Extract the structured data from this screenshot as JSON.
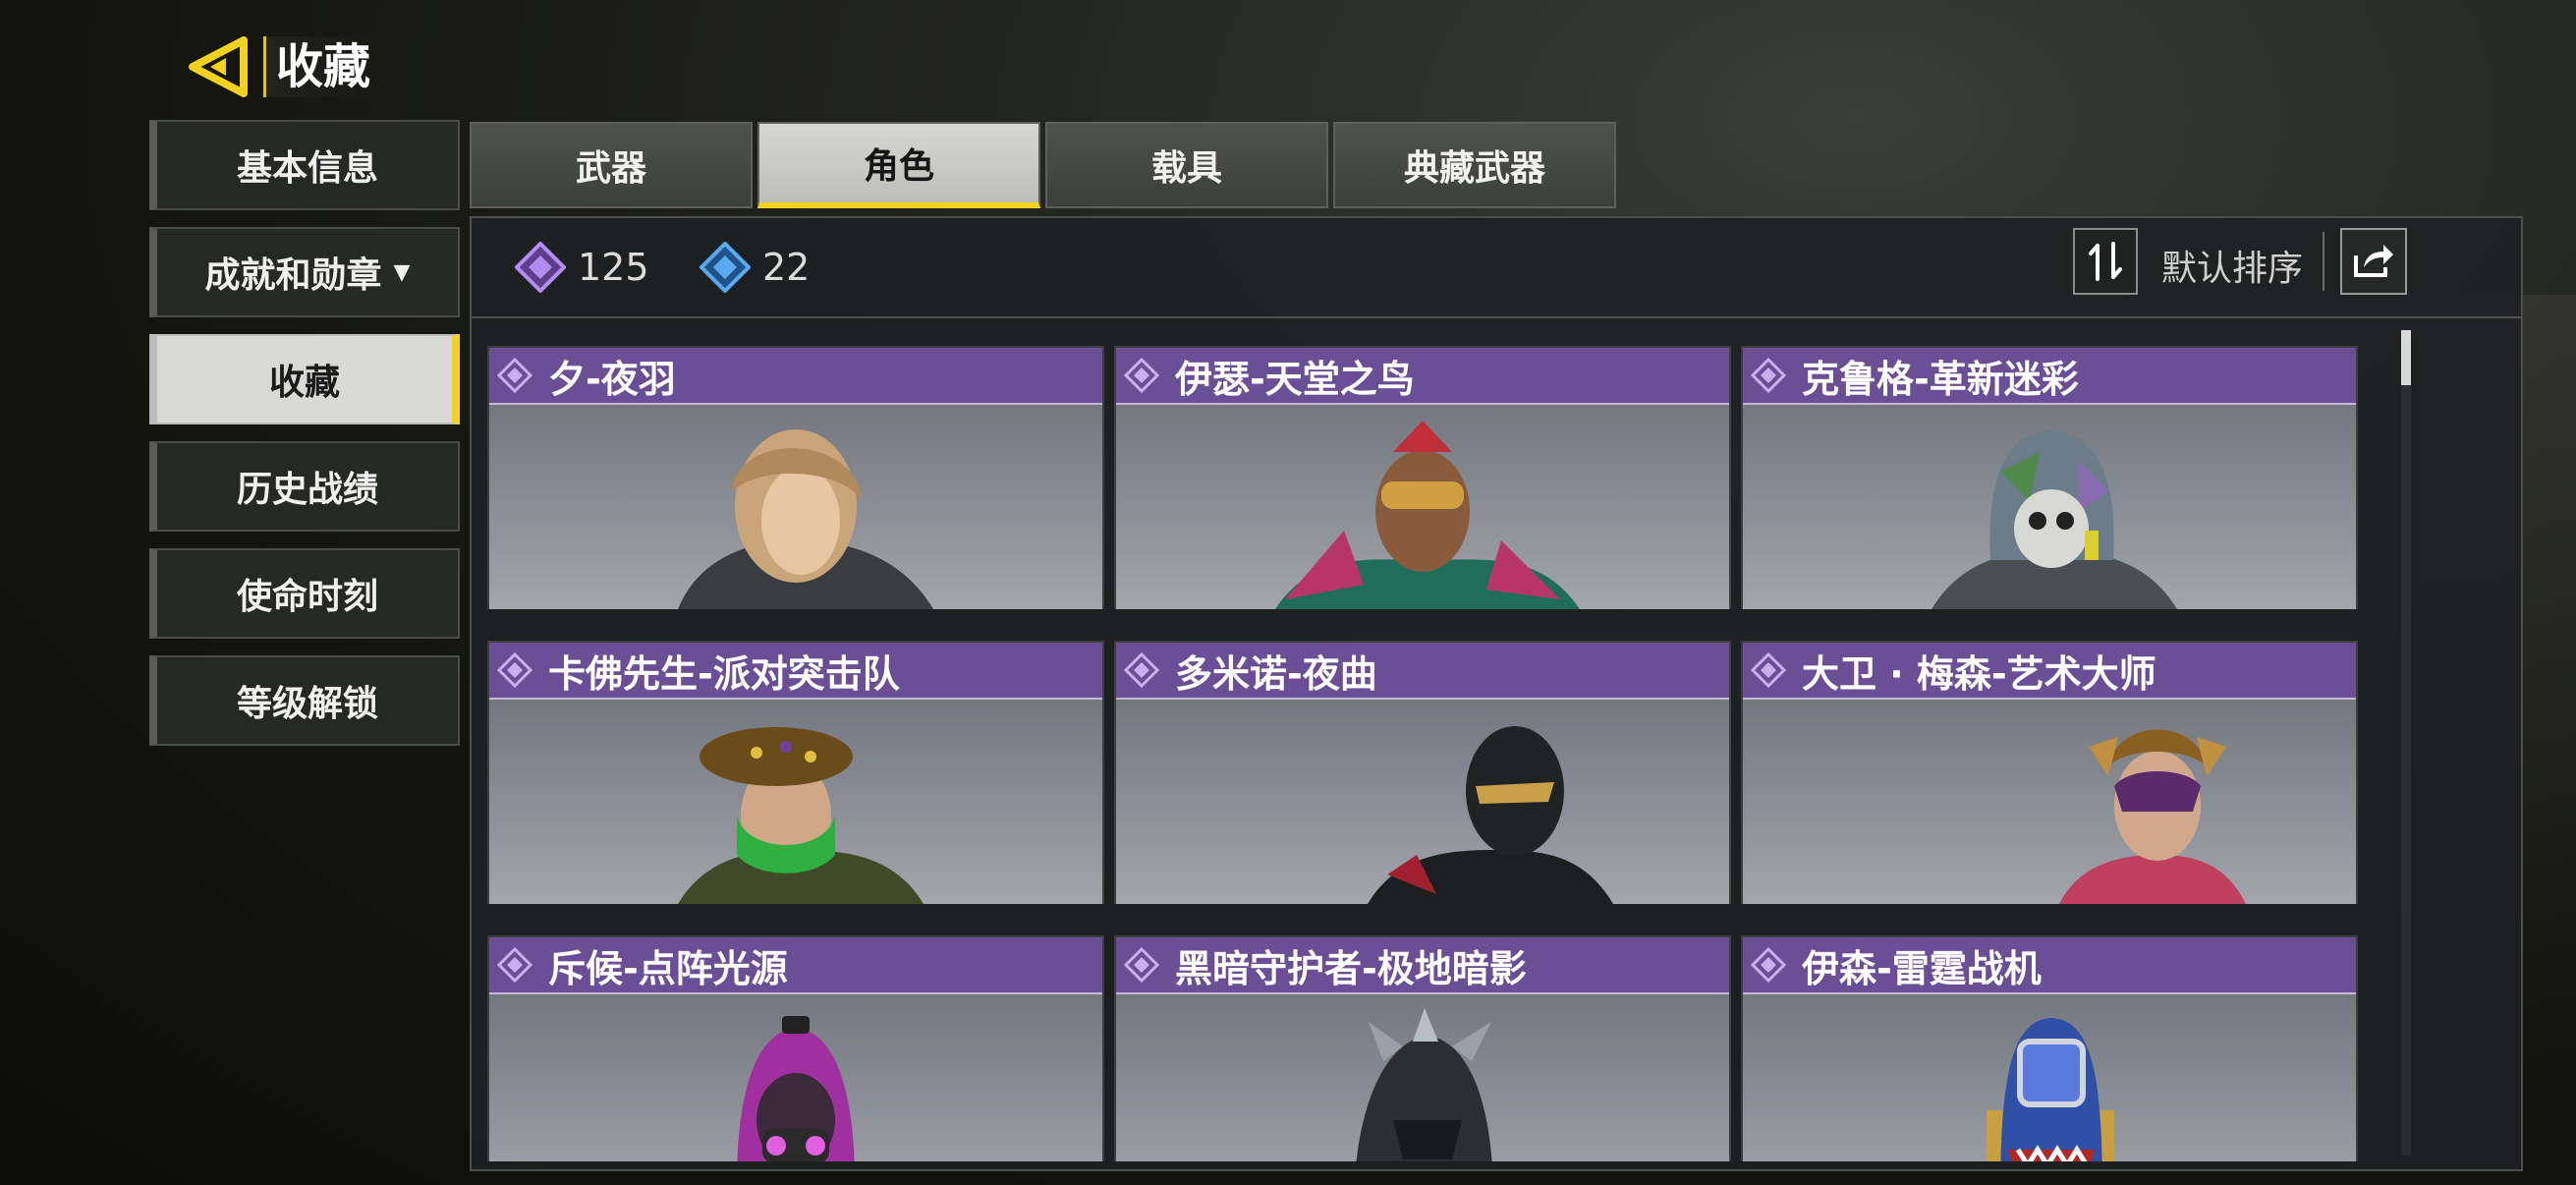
{
  "header": {
    "title": "收藏"
  },
  "sidebar": {
    "items": [
      {
        "label": "基本信息",
        "active": false
      },
      {
        "label": "成就和勋章",
        "active": false,
        "dropdown": true
      },
      {
        "label": "收藏",
        "active": true
      },
      {
        "label": "历史战绩",
        "active": false
      },
      {
        "label": "使命时刻",
        "active": false
      },
      {
        "label": "等级解锁",
        "active": false
      }
    ]
  },
  "tabs": [
    {
      "label": "武器",
      "active": false
    },
    {
      "label": "角色",
      "active": true
    },
    {
      "label": "载具",
      "active": false
    },
    {
      "label": "典藏武器",
      "active": false
    }
  ],
  "currencies": [
    {
      "icon": "purple-diamond-icon",
      "value": "125",
      "color": "#a77be0"
    },
    {
      "icon": "blue-diamond-icon",
      "value": "22",
      "color": "#4f9de0"
    }
  ],
  "sort": {
    "label": "默认排序"
  },
  "cards": [
    {
      "name": "夕-夜羽",
      "portrait": "blonde-woman-portrait"
    },
    {
      "name": "伊瑟-天堂之鸟",
      "portrait": "feathered-mask-portrait"
    },
    {
      "name": "克鲁格-革新迷彩",
      "portrait": "camo-hood-portrait"
    },
    {
      "name": "卡佛先生-派对突击队",
      "portrait": "beret-green-mask-portrait"
    },
    {
      "name": "多米诺-夜曲",
      "portrait": "black-balaclava-portrait"
    },
    {
      "name": "大卫 · 梅森-艺术大师",
      "portrait": "jester-mask-portrait"
    },
    {
      "name": "斥候-点阵光源",
      "portrait": "neon-hood-portrait"
    },
    {
      "name": "黑暗守护者-极地暗影",
      "portrait": "spiked-helmet-portrait"
    },
    {
      "name": "伊森-雷霆战机",
      "portrait": "shark-helmet-portrait"
    }
  ],
  "colors": {
    "accent": "#f2d21d",
    "card_header": "#6b4f96",
    "panel": "#1e2022"
  }
}
